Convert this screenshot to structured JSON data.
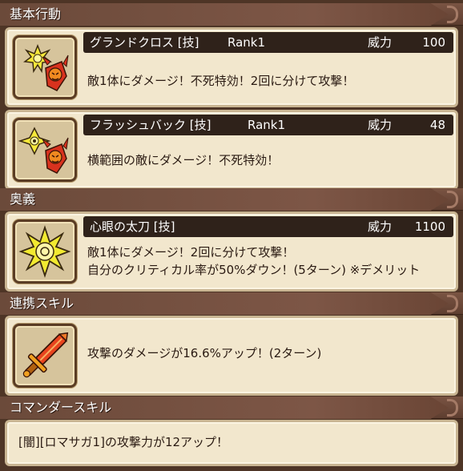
{
  "sections": {
    "basic": {
      "label": "基本行動"
    },
    "ougi": {
      "label": "奥義"
    },
    "renkei": {
      "label": "連携スキル"
    },
    "commander": {
      "label": "コマンダースキル"
    }
  },
  "skills": [
    {
      "name": "グランドクロス [技]",
      "rank": "Rank1",
      "power_label": "威力",
      "power": "100",
      "desc": [
        "敵1体にダメージ！不死特効！2回に分けて攻撃！"
      ],
      "icon": "grand-cross-icon"
    },
    {
      "name": "フラッシュバック [技]",
      "rank": "Rank1",
      "power_label": "威力",
      "power": "48",
      "desc": [
        "横範囲の敵にダメージ！不死特効！"
      ],
      "icon": "flashback-icon"
    }
  ],
  "ougi": {
    "name": "心眼の太刀 [技]",
    "power_label": "威力",
    "power": "1100",
    "desc": [
      "敵1体にダメージ！2回に分けて攻撃！",
      "自分のクリティカル率が50%ダウン！(5ターン) ※デメリット"
    ],
    "icon": "shingan-icon"
  },
  "renkei": {
    "desc": "攻撃のダメージが16.6%アップ！(2ターン)",
    "icon": "sword-icon"
  },
  "commander": {
    "desc": "[闇][ロマサガ1]の攻撃力が12アップ！"
  },
  "colors": {
    "card_bg": "#f2e7cd",
    "title_bar": "#2f221a",
    "header_bg": "#6b4a3a"
  }
}
